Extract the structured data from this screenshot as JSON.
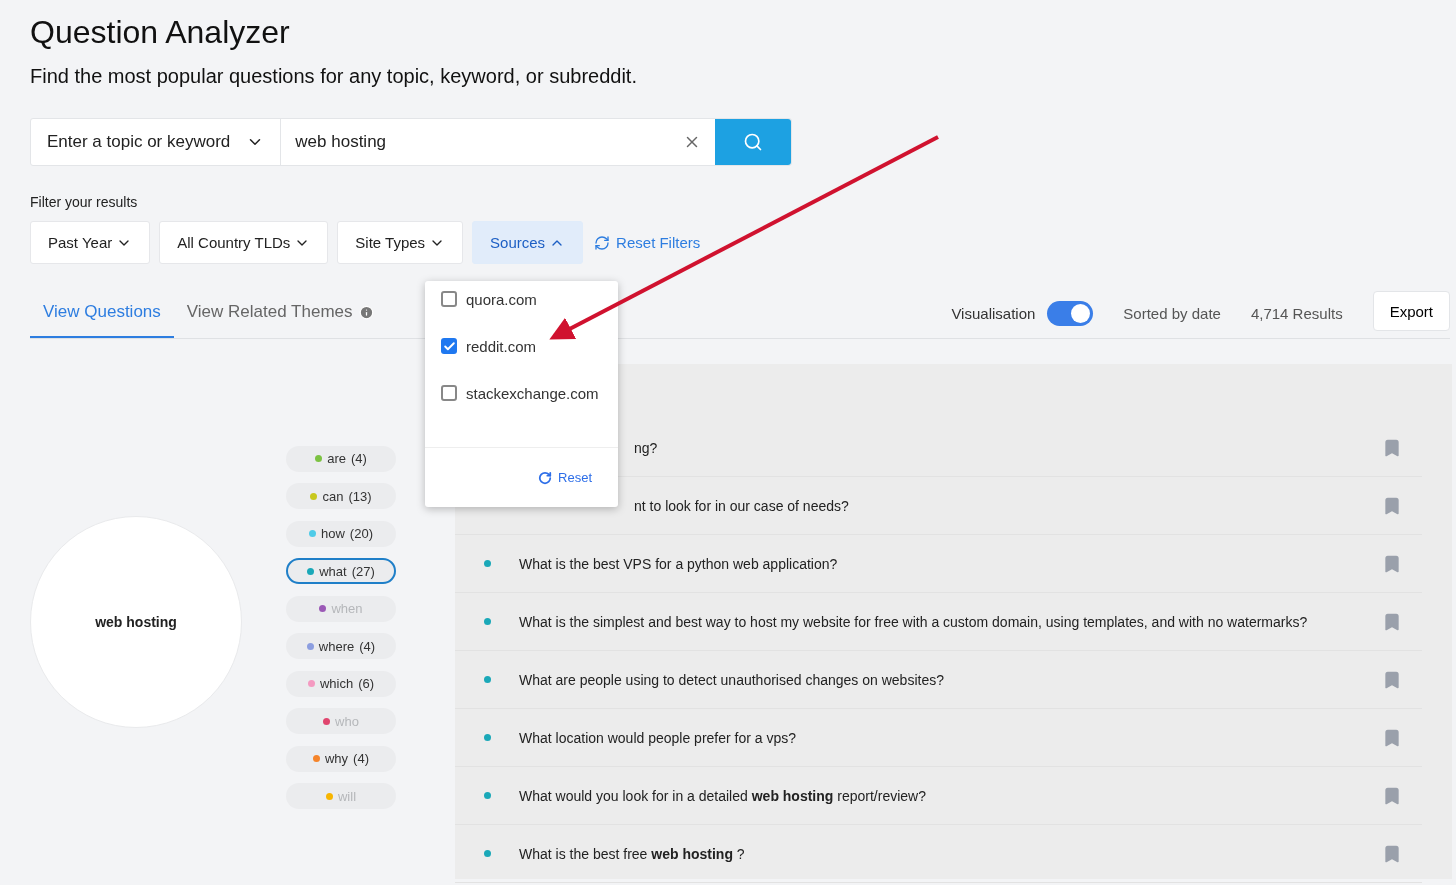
{
  "header": {
    "title": "Question Analyzer",
    "subtitle": "Find the most popular questions for any topic, keyword, or subreddit."
  },
  "search": {
    "mode": "Enter a topic or keyword",
    "value": "web hosting"
  },
  "filters": {
    "label": "Filter your results",
    "buttons": [
      {
        "label": "Past Year",
        "open": false
      },
      {
        "label": "All Country TLDs",
        "open": false
      },
      {
        "label": "Site Types",
        "open": false
      },
      {
        "label": "Sources",
        "open": true
      }
    ],
    "reset": "Reset Filters",
    "dropdown": {
      "options": [
        {
          "label": "quora.com",
          "checked": false
        },
        {
          "label": "reddit.com",
          "checked": true
        },
        {
          "label": "stackexchange.com",
          "checked": false
        }
      ],
      "reset": "Reset"
    }
  },
  "tabs": [
    {
      "label": "View Questions",
      "selected": true,
      "info": false
    },
    {
      "label": "View Related Themes",
      "selected": false,
      "info": true
    }
  ],
  "toolbar": {
    "visualisation": {
      "label": "Visualisation",
      "on": true
    },
    "sort": "Sorted by date",
    "results": "4,714 Results",
    "export": "Export"
  },
  "topic": "web hosting",
  "words": [
    {
      "label": "are",
      "count": "(4)",
      "color": "#7cc242",
      "selected": false,
      "disabled": false
    },
    {
      "label": "can",
      "count": "(13)",
      "color": "#c8c81e",
      "selected": false,
      "disabled": false
    },
    {
      "label": "how",
      "count": "(20)",
      "color": "#4ecbe8",
      "selected": false,
      "disabled": false
    },
    {
      "label": "what",
      "count": "(27)",
      "color": "#1aa8b8",
      "selected": true,
      "disabled": false
    },
    {
      "label": "when",
      "color": "#9b59b6",
      "selected": false,
      "disabled": true
    },
    {
      "label": "where",
      "count": "(4)",
      "color": "#8c9ee0",
      "selected": false,
      "disabled": false
    },
    {
      "label": "which",
      "count": "(6)",
      "color": "#f49ac1",
      "selected": false,
      "disabled": false
    },
    {
      "label": "who",
      "color": "#e0456e",
      "selected": false,
      "disabled": true
    },
    {
      "label": "why",
      "count": "(4)",
      "color": "#f5842a",
      "selected": false,
      "disabled": false
    },
    {
      "label": "will",
      "color": "#f7b500",
      "selected": false,
      "disabled": true
    }
  ],
  "questions": [
    {
      "text": "ng?",
      "kind": "covered"
    },
    {
      "text": "nt to look for in our case of needs?",
      "kind": "covered"
    },
    {
      "text": "What is the best VPS for a python web application?",
      "kind": "full"
    },
    {
      "text": "What is the simplest and best way to host my website for free with a custom domain, using templates, and with no watermarks?",
      "kind": "full"
    },
    {
      "text": "What are people using to detect unauthorised changes on websites?",
      "kind": "full"
    },
    {
      "text": "What location would people prefer for a vps?",
      "kind": "full"
    },
    {
      "text": "What would you look for in a detailed **web hosting** report/review?",
      "kind": "full"
    },
    {
      "text": "What is the best free **web hosting** ?",
      "kind": "full"
    }
  ]
}
